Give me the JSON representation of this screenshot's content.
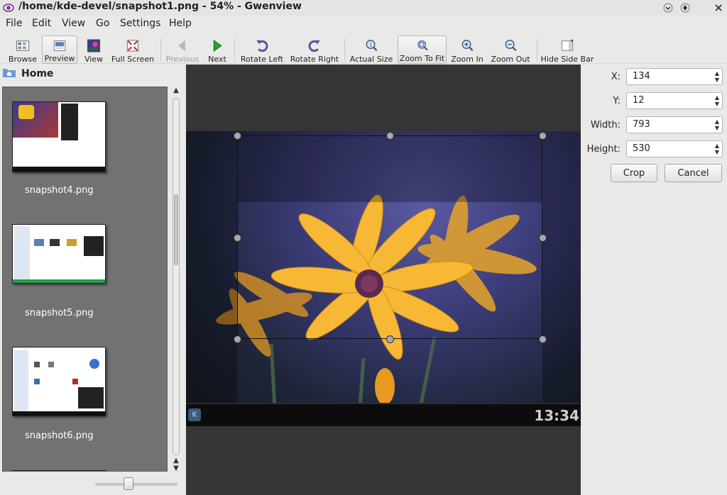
{
  "window": {
    "title": "/home/kde-devel/snapshot1.png - 54% - Gwenview"
  },
  "menubar": {
    "items": [
      {
        "label": "File"
      },
      {
        "label": "Edit"
      },
      {
        "label": "View"
      },
      {
        "label": "Go"
      },
      {
        "label": "Settings"
      },
      {
        "label": "Help"
      }
    ]
  },
  "toolbar": {
    "browse": "Browse",
    "preview": "Preview",
    "view": "View",
    "full_screen": "Full Screen",
    "previous": "Previous",
    "next": "Next",
    "rotate_left": "Rotate Left",
    "rotate_right": "Rotate Right",
    "actual_size": "Actual Size",
    "zoom_to_fit": "Zoom To Fit",
    "zoom_in": "Zoom In",
    "zoom_out": "Zoom Out",
    "hide_side_bar": "Hide Side Bar"
  },
  "sidebar": {
    "location": "Home",
    "thumbnails": [
      {
        "name": "snapshot4.png"
      },
      {
        "name": "snapshot5.png"
      },
      {
        "name": "snapshot6.png"
      }
    ]
  },
  "viewer": {
    "clock": "13:34"
  },
  "crop_panel": {
    "x_label": "X:",
    "x_value": "134",
    "y_label": "Y:",
    "y_value": "12",
    "width_label": "Width:",
    "width_value": "793",
    "height_label": "Height:",
    "height_value": "530",
    "crop_button": "Crop",
    "cancel_button": "Cancel"
  },
  "colors": {
    "thumb_background": "#727272",
    "viewer_background": "#353535",
    "next_arrow": "#2aa02a",
    "rotate_icon": "#5a4fa0"
  }
}
